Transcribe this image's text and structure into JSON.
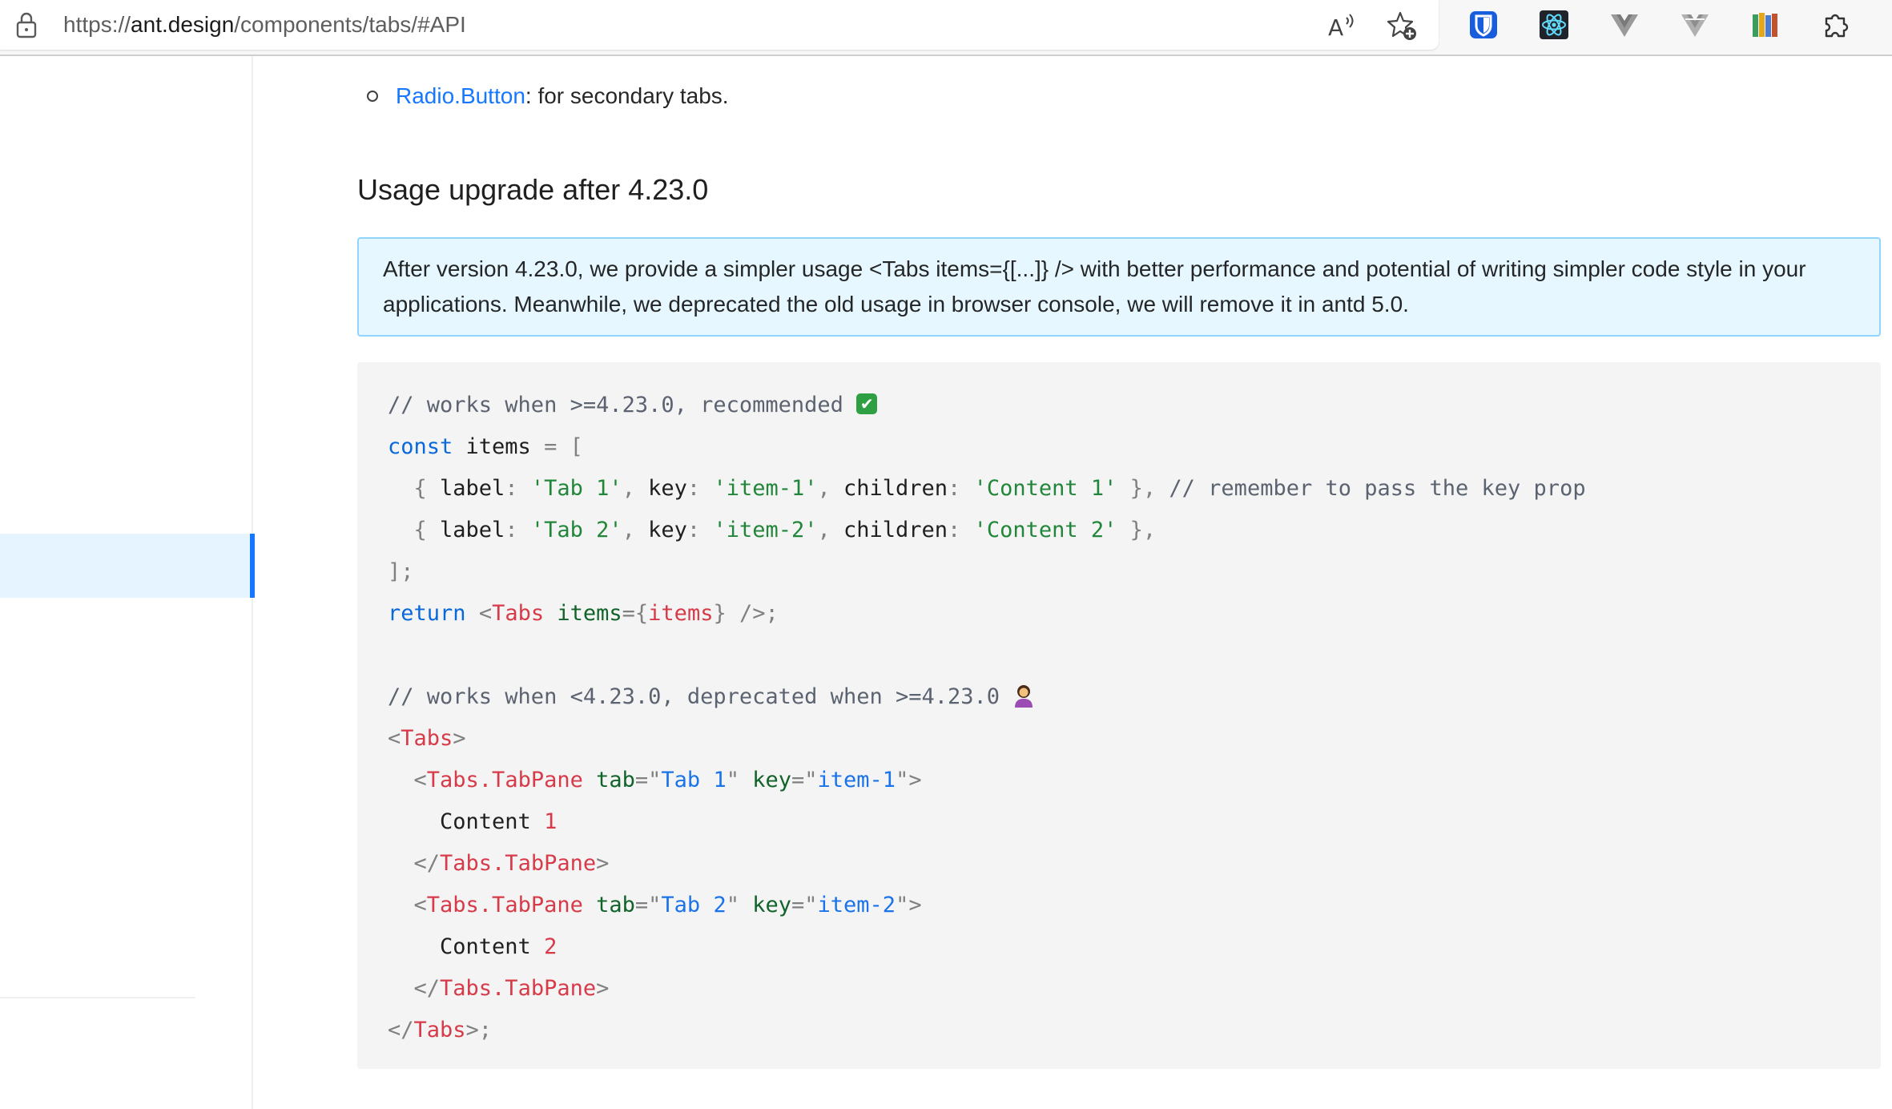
{
  "browser": {
    "url_prefix": "https://",
    "url_host": "ant.design",
    "url_path": "/components/tabs/#API",
    "icons": [
      "lock-icon",
      "read-aloud-icon",
      "add-favorite-icon",
      "bitwarden-extension-icon",
      "react-devtools-extension-icon",
      "vue-devtools-extension-icon",
      "vue-devtools-alt-extension-icon",
      "books-extension-icon",
      "extensions-puzzle-icon"
    ]
  },
  "content": {
    "bullet_link": "Radio.Button",
    "bullet_rest": ": for secondary tabs.",
    "section_title": "Usage upgrade after 4.23.0",
    "alert_text": "After version 4.23.0, we provide a simpler usage <Tabs items={[...]} /> with better performance and potential of writing simpler code style in your applications. Meanwhile, we deprecated the old usage in browser console, we will remove it in antd 5.0."
  },
  "code": {
    "lines": [
      [
        [
          "comment",
          "// works when >=4.23.0, recommended "
        ],
        [
          "emoji-check",
          "✔"
        ]
      ],
      [
        [
          "keyword",
          "const"
        ],
        [
          "plain",
          " items "
        ],
        [
          "punct",
          "= ["
        ]
      ],
      [
        [
          "plain",
          "  "
        ],
        [
          "punct",
          "{ "
        ],
        [
          "plain",
          "label"
        ],
        [
          "punct",
          ": "
        ],
        [
          "string",
          "'Tab 1'"
        ],
        [
          "punct",
          ", "
        ],
        [
          "plain",
          "key"
        ],
        [
          "punct",
          ": "
        ],
        [
          "string",
          "'item-1'"
        ],
        [
          "punct",
          ", "
        ],
        [
          "plain",
          "children"
        ],
        [
          "punct",
          ": "
        ],
        [
          "string",
          "'Content 1'"
        ],
        [
          "punct",
          " }, "
        ],
        [
          "comment",
          "// remember to pass the key prop"
        ]
      ],
      [
        [
          "plain",
          "  "
        ],
        [
          "punct",
          "{ "
        ],
        [
          "plain",
          "label"
        ],
        [
          "punct",
          ": "
        ],
        [
          "string",
          "'Tab 2'"
        ],
        [
          "punct",
          ", "
        ],
        [
          "plain",
          "key"
        ],
        [
          "punct",
          ": "
        ],
        [
          "string",
          "'item-2'"
        ],
        [
          "punct",
          ", "
        ],
        [
          "plain",
          "children"
        ],
        [
          "punct",
          ": "
        ],
        [
          "string",
          "'Content 2'"
        ],
        [
          "punct",
          " },"
        ]
      ],
      [
        [
          "punct",
          "];"
        ]
      ],
      [
        [
          "keyword",
          "return"
        ],
        [
          "plain",
          " "
        ],
        [
          "punct",
          "<"
        ],
        [
          "tag",
          "Tabs"
        ],
        [
          "plain",
          " "
        ],
        [
          "attr",
          "items"
        ],
        [
          "punct",
          "={"
        ],
        [
          "tag",
          "items"
        ],
        [
          "punct",
          "} />;"
        ]
      ],
      [],
      [
        [
          "comment",
          "// works when <4.23.0, deprecated when >=4.23.0 "
        ],
        [
          "emoji-person",
          ""
        ]
      ],
      [
        [
          "punct",
          "<"
        ],
        [
          "tag",
          "Tabs"
        ],
        [
          "punct",
          ">"
        ]
      ],
      [
        [
          "plain",
          "  "
        ],
        [
          "punct",
          "<"
        ],
        [
          "tag",
          "Tabs.TabPane"
        ],
        [
          "plain",
          " "
        ],
        [
          "attr",
          "tab"
        ],
        [
          "punct",
          "=\""
        ],
        [
          "attrval",
          "Tab 1"
        ],
        [
          "punct",
          "\""
        ],
        [
          "plain",
          " "
        ],
        [
          "attr",
          "key"
        ],
        [
          "punct",
          "=\""
        ],
        [
          "attrval",
          "item-1"
        ],
        [
          "punct",
          "\">"
        ]
      ],
      [
        [
          "plain",
          "    Content "
        ],
        [
          "number",
          "1"
        ]
      ],
      [
        [
          "plain",
          "  "
        ],
        [
          "punct",
          "</"
        ],
        [
          "tag",
          "Tabs.TabPane"
        ],
        [
          "punct",
          ">"
        ]
      ],
      [
        [
          "plain",
          "  "
        ],
        [
          "punct",
          "<"
        ],
        [
          "tag",
          "Tabs.TabPane"
        ],
        [
          "plain",
          " "
        ],
        [
          "attr",
          "tab"
        ],
        [
          "punct",
          "=\""
        ],
        [
          "attrval",
          "Tab 2"
        ],
        [
          "punct",
          "\""
        ],
        [
          "plain",
          " "
        ],
        [
          "attr",
          "key"
        ],
        [
          "punct",
          "=\""
        ],
        [
          "attrval",
          "item-2"
        ],
        [
          "punct",
          "\">"
        ]
      ],
      [
        [
          "plain",
          "    Content "
        ],
        [
          "number",
          "2"
        ]
      ],
      [
        [
          "plain",
          "  "
        ],
        [
          "punct",
          "</"
        ],
        [
          "tag",
          "Tabs.TabPane"
        ],
        [
          "punct",
          ">"
        ]
      ],
      [
        [
          "punct",
          "</"
        ],
        [
          "tag",
          "Tabs"
        ],
        [
          "punct",
          ">;"
        ]
      ]
    ]
  },
  "colors": {
    "link": "#1677ff",
    "alert_bg": "#e6f7ff",
    "alert_border": "#91d5ff",
    "code_bg": "#f4f4f4",
    "sidebar_active_bg": "#e6f4ff"
  }
}
